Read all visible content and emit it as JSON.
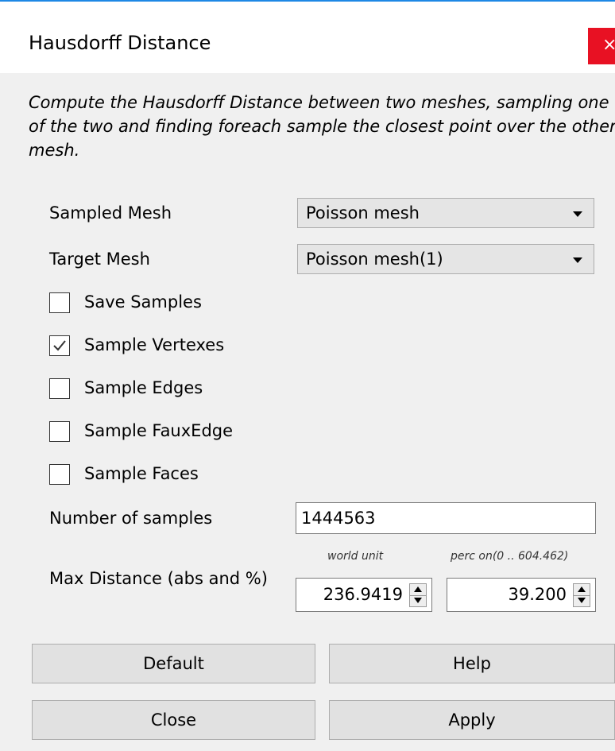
{
  "window": {
    "title": "Hausdorff Distance",
    "close_glyph": "×"
  },
  "description": "Compute the Hausdorff Distance between two meshes, sampling one of the two and finding foreach sample the closest point over the other mesh.",
  "sampled_mesh": {
    "label": "Sampled Mesh",
    "value": "Poisson mesh"
  },
  "target_mesh": {
    "label": "Target Mesh",
    "value": "Poisson mesh(1)"
  },
  "checkboxes": [
    {
      "label": "Save Samples",
      "checked": false
    },
    {
      "label": "Sample Vertexes",
      "checked": true
    },
    {
      "label": "Sample Edges",
      "checked": false
    },
    {
      "label": "Sample FauxEdge",
      "checked": false
    },
    {
      "label": "Sample Faces",
      "checked": false
    }
  ],
  "num_samples": {
    "label": "Number of samples",
    "value": "1444563"
  },
  "max_distance": {
    "label": "Max Distance (abs and %)",
    "abs_caption": "world unit",
    "perc_caption": "perc on(0 .. 604.462)",
    "abs_value": "236.9419",
    "perc_value": "39.200"
  },
  "buttons": {
    "default": "Default",
    "help": "Help",
    "close": "Close",
    "apply": "Apply"
  },
  "colors": {
    "title_accent": "#1e88e5",
    "close_button": "#e81123"
  }
}
